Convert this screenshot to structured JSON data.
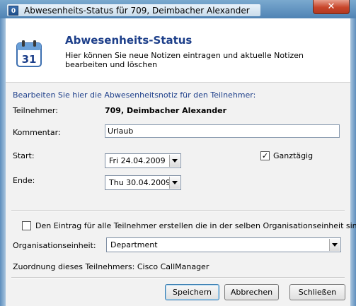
{
  "window": {
    "title": "Abwesenheits-Status für 709, Deimbacher Alexander",
    "app_icon_glyph": "0",
    "close_glyph": "✕"
  },
  "header": {
    "title": "Abwesenheits-Status",
    "description": "Hier können Sie neue Notizen eintragen und aktuelle Notizen bearbeiten und löschen",
    "icon": "calendar-icon",
    "calendar_day": "31"
  },
  "form": {
    "hint": "Bearbeiten Sie hier die Abwesenheitsnotiz für den Teilnehmer:",
    "participant_label": "Teilnehmer:",
    "participant_value": "709, Deimbacher Alexander",
    "comment_label": "Kommentar:",
    "comment_value": "Urlaub",
    "start_label": "Start:",
    "start_value": "Fri  24.04.2009",
    "end_label": "Ende:",
    "end_value": "Thu  30.04.2009",
    "allday_label": "Ganztägig",
    "allday_checked": true,
    "all_members_label": "Den Eintrag für alle Teilnehmer erstellen die in der selben Organisationseinheit sind",
    "all_members_checked": false,
    "org_unit_label": "Organisationseinheit:",
    "org_unit_value": "Department",
    "assignment_text": "Zuordnung dieses Teilnehmers: Cisco CallManager"
  },
  "buttons": {
    "save": "Speichern",
    "cancel": "Abbrechen",
    "close": "Schließen"
  },
  "colors": {
    "accent": "#1d3f8a",
    "titlebar": "#4f83b4",
    "close_button": "#c8452a"
  }
}
